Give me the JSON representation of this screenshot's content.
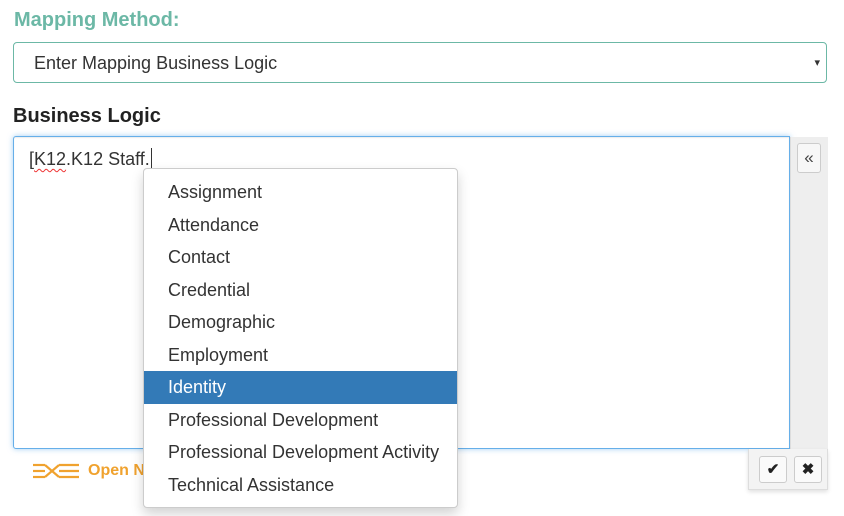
{
  "mapping_method": {
    "label": "Mapping Method:",
    "selected": "Enter Mapping Business Logic",
    "caret_icon": "caret-down-icon"
  },
  "business_logic": {
    "label": "Business Logic",
    "editor_text_underlined": "K12",
    "editor_text_prefix": "[",
    "editor_text_rest": ".K12 Staff.",
    "collapse_icon": "double-chevron-left-icon"
  },
  "open_link": {
    "label": "Open N",
    "icon": "ceds-logo-icon",
    "color": "#f0a22e"
  },
  "actions": {
    "confirm_icon": "checkmark-icon",
    "cancel_icon": "close-icon"
  },
  "autocomplete": {
    "items": [
      {
        "label": "Assignment",
        "active": false
      },
      {
        "label": "Attendance",
        "active": false
      },
      {
        "label": "Contact",
        "active": false
      },
      {
        "label": "Credential",
        "active": false
      },
      {
        "label": "Demographic",
        "active": false
      },
      {
        "label": "Employment",
        "active": false
      },
      {
        "label": "Identity",
        "active": true
      },
      {
        "label": "Professional Development",
        "active": false
      },
      {
        "label": "Professional Development Activity",
        "active": false
      },
      {
        "label": "Technical Assistance",
        "active": false
      }
    ],
    "active_color": "#337ab7"
  },
  "colors": {
    "accent": "#6cb8a6",
    "focus_border": "#66afe9"
  }
}
